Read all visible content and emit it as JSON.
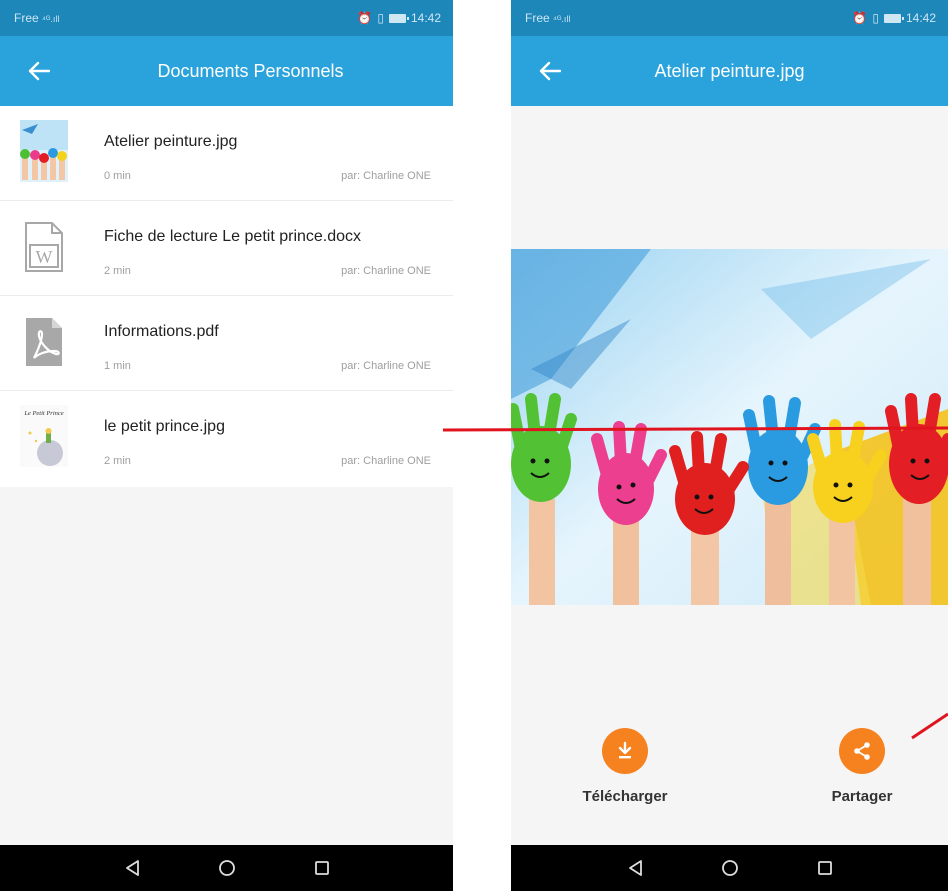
{
  "status_bar": {
    "carrier": "Free",
    "signal": "⁴ᴳ.ıll",
    "time": "14:42"
  },
  "list_screen": {
    "title": "Documents Personnels",
    "files": [
      {
        "name": "Atelier peinture.jpg",
        "time": "0 min",
        "author": "par: Charline ONE",
        "thumb": "painted-hands-thumbnail"
      },
      {
        "name": "Fiche de lecture Le petit prince.docx",
        "time": "2 min",
        "author": "par: Charline ONE",
        "thumb": "word-document-icon"
      },
      {
        "name": "Informations.pdf",
        "time": "1 min",
        "author": "par: Charline ONE",
        "thumb": "pdf-document-icon"
      },
      {
        "name": "le petit prince.jpg",
        "time": "2 min",
        "author": "par: Charline ONE",
        "thumb": "petit-prince-thumbnail",
        "thumb_text": "Le Petit Prince"
      }
    ]
  },
  "viewer_screen": {
    "title": "Atelier peinture.jpg",
    "image": "painted-hands-photo",
    "actions": [
      {
        "label": "Télécharger",
        "icon": "download-icon"
      },
      {
        "label": "Partager",
        "icon": "share-icon"
      }
    ]
  },
  "nav_icons": [
    "back-triangle-icon",
    "home-circle-icon",
    "recents-square-icon"
  ],
  "colors": {
    "status_bar": "#1d87ba",
    "app_bar": "#2aa3dc",
    "accent": "#f6821f",
    "annotation": "#e0141e"
  }
}
